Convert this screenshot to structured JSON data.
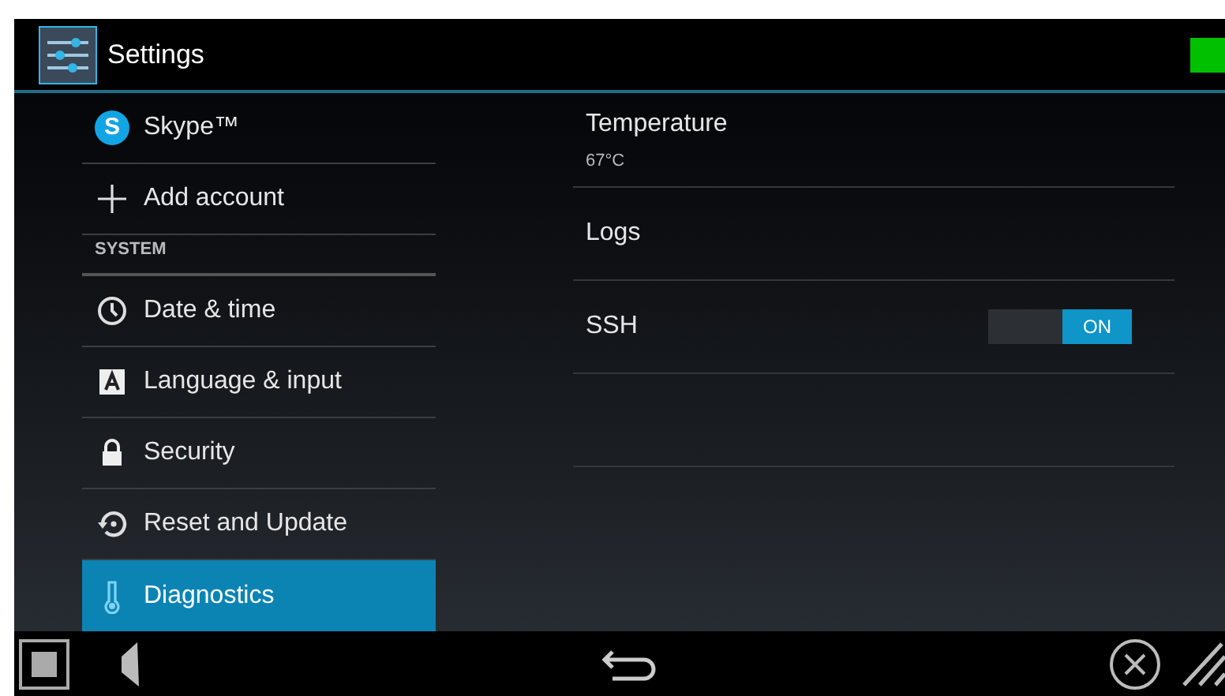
{
  "action_bar": {
    "title": "Settings"
  },
  "sidebar": {
    "items": [
      {
        "kind": "item",
        "logo_letter": "S",
        "label": "Skype™",
        "selected": false
      },
      {
        "kind": "item",
        "label": "Add account",
        "selected": false
      },
      {
        "kind": "header",
        "label": "SYSTEM"
      },
      {
        "kind": "item",
        "label": "Date & time",
        "selected": false
      },
      {
        "kind": "item",
        "label": "Language & input",
        "selected": false
      },
      {
        "kind": "item",
        "label": "Security",
        "selected": false
      },
      {
        "kind": "item",
        "label": "Reset and Update",
        "selected": false
      },
      {
        "kind": "item",
        "label": "Diagnostics",
        "selected": true
      }
    ]
  },
  "detail": {
    "rows": [
      {
        "kind": "info",
        "title": "Temperature",
        "summary": "67°C"
      },
      {
        "kind": "plain",
        "title": "Logs"
      },
      {
        "kind": "switch",
        "title": "SSH",
        "on": true,
        "state_label": "ON"
      },
      {
        "kind": "empty"
      }
    ]
  }
}
